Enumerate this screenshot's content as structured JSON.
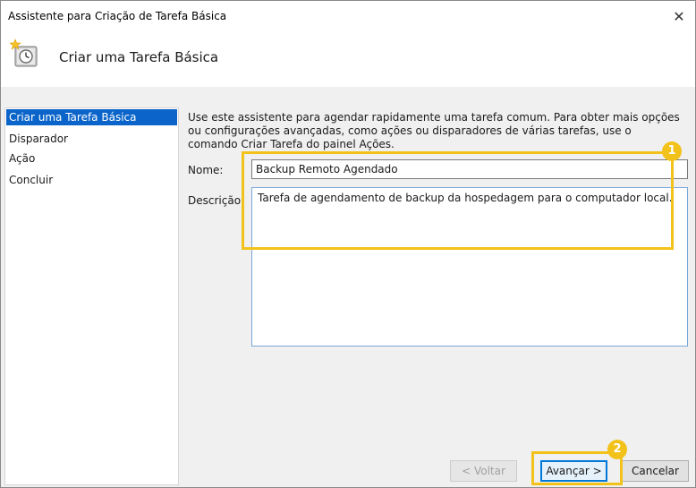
{
  "window": {
    "title": "Assistente para Criação de Tarefa Básica",
    "close_glyph": "✕"
  },
  "header": {
    "title": "Criar uma Tarefa Básica",
    "icon": "scheduled-task-icon"
  },
  "sidebar": {
    "items": [
      {
        "label": "Criar uma Tarefa Básica",
        "active": true
      },
      {
        "label": "Disparador",
        "active": false
      },
      {
        "label": "Ação",
        "active": false
      },
      {
        "label": "Concluir",
        "active": false
      }
    ]
  },
  "content": {
    "intro": "Use este assistente para agendar rapidamente uma tarefa comum. Para obter mais opções ou configurações avançadas, como ações ou disparadores de várias tarefas, use o comando Criar Tarefa do painel Ações.",
    "name_label": "Nome:",
    "name_value": "Backup Remoto Agendado",
    "description_label": "Descrição:",
    "description_value": "Tarefa de agendamento de backup da hospedagem para o computador local."
  },
  "buttons": {
    "back": "< Voltar",
    "next": "Avançar >",
    "cancel": "Cancelar"
  },
  "annotations": {
    "marker_1": "1",
    "marker_2": "2",
    "color": "#f2c21a"
  },
  "colors": {
    "selection": "#0a64c9",
    "focus": "#0078d7"
  }
}
